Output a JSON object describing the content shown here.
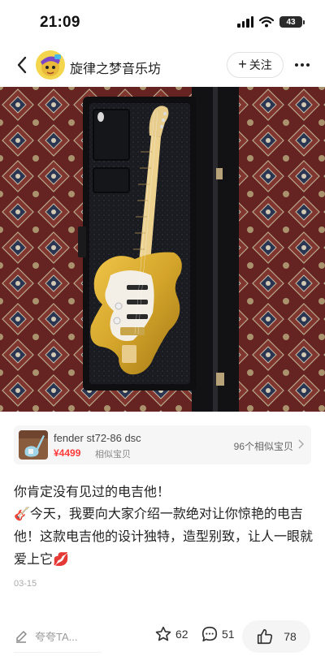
{
  "status_bar": {
    "time": "21:09",
    "battery": "43"
  },
  "header": {
    "author_name": "旋律之梦音乐坊",
    "follow_label": "关注"
  },
  "product": {
    "name": "fender st72-86 dsc",
    "price": "¥4499",
    "tag": "相似宝贝",
    "similar_count": "96个相似宝贝"
  },
  "post": {
    "title": "你肯定没有见过的电吉他！",
    "body": "🎸今天，我要向大家介绍一款绝对让你惊艳的电吉他！这款电吉他的设计独特，造型别致，让人一眼就爱上它💋",
    "date": "03-15"
  },
  "actions": {
    "comment_placeholder": "夸夸TA...",
    "favorites": "62",
    "comments": "51",
    "likes": "78"
  },
  "icons": [
    "back-icon",
    "follow-plus-icon",
    "more-icon",
    "chevron-right-icon",
    "pen-icon",
    "star-icon",
    "comment-icon",
    "thumbs-up-icon"
  ],
  "colors": {
    "price_red": "#ff3a3a",
    "guitar_gold": "#d4a52a",
    "case_black": "#1b1b1d",
    "rug_red": "#7a2a28"
  }
}
